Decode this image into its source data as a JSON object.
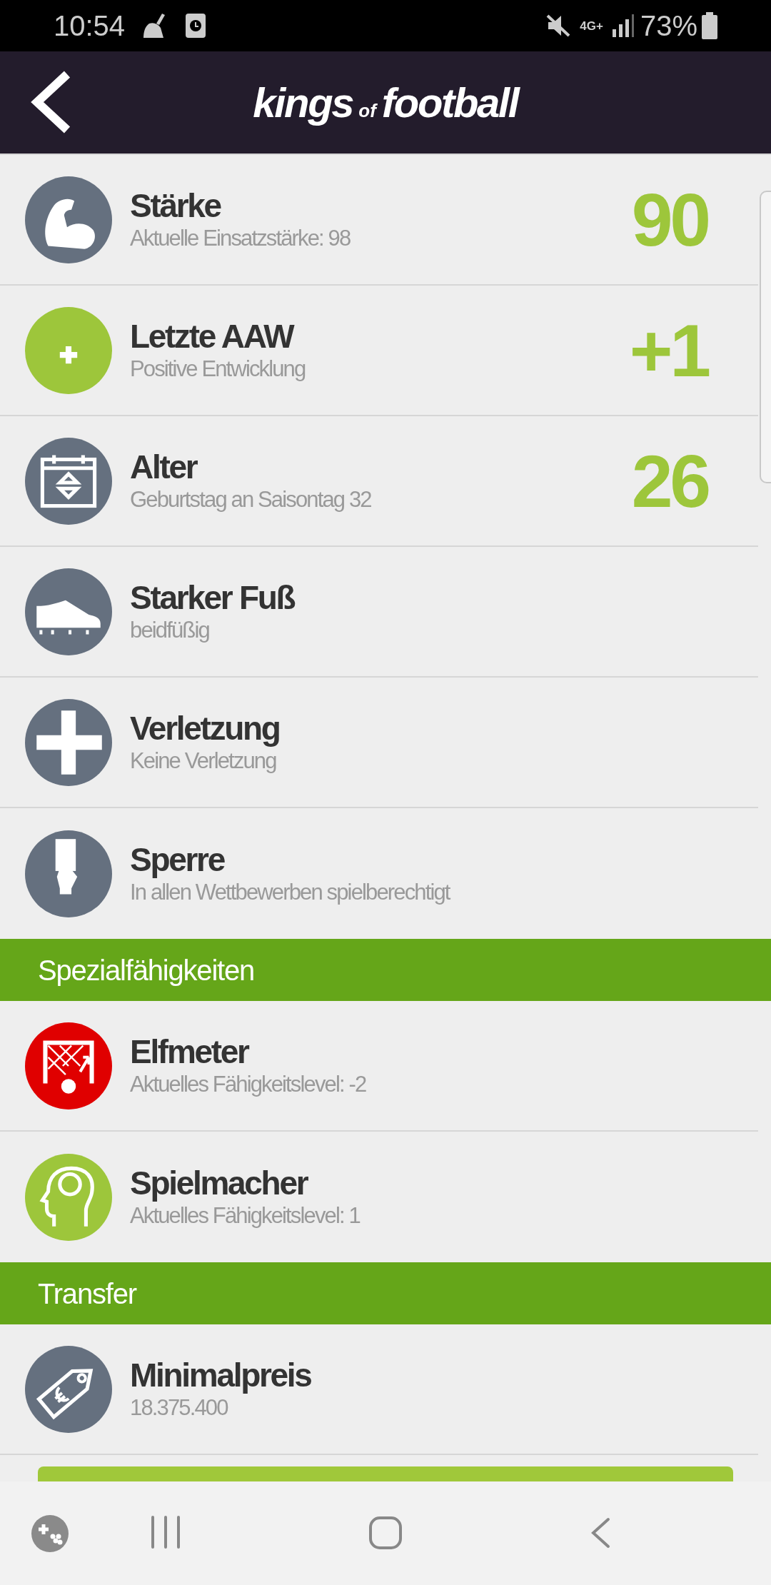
{
  "status_bar": {
    "time": "10:54",
    "network": "4G+",
    "battery": "73%"
  },
  "header": {
    "logo": [
      "kings",
      "of",
      "football"
    ]
  },
  "list": [
    {
      "kind": "row",
      "title": "Stärke",
      "subtitle": "Aktuelle Einsatzstärke: 98",
      "value": "90",
      "color": "#65707f"
    },
    {
      "kind": "row",
      "title": "Letzte AAW",
      "subtitle": "Positive Entwicklung",
      "value": "+1",
      "color": "#9dc63b"
    },
    {
      "kind": "row",
      "title": "Alter",
      "subtitle": "Geburtstag an Saisontag 32",
      "value": "26",
      "color": "#65707f"
    },
    {
      "kind": "row",
      "title": "Starker Fuß",
      "subtitle": "beidfüßig",
      "color": "#65707f"
    },
    {
      "kind": "row",
      "title": "Verletzung",
      "subtitle": "Keine Verletzung",
      "color": "#65707f"
    },
    {
      "kind": "row",
      "title": "Sperre",
      "subtitle": "In allen Wettbewerben spielberechtigt",
      "color": "#65707f"
    },
    {
      "kind": "section",
      "title": "Spezialfähigkeiten"
    },
    {
      "kind": "row",
      "title": "Elfmeter",
      "subtitle": "Aktuelles Fähigkeitslevel: -2",
      "color": "#e00000"
    },
    {
      "kind": "row",
      "title": "Spielmacher",
      "subtitle": "Aktuelles Fähigkeitslevel: 1",
      "color": "#9dc63b"
    },
    {
      "kind": "section",
      "title": "Transfer"
    },
    {
      "kind": "row",
      "title": "Minimalpreis",
      "subtitle": "18.375.400",
      "color": "#65707f"
    }
  ]
}
